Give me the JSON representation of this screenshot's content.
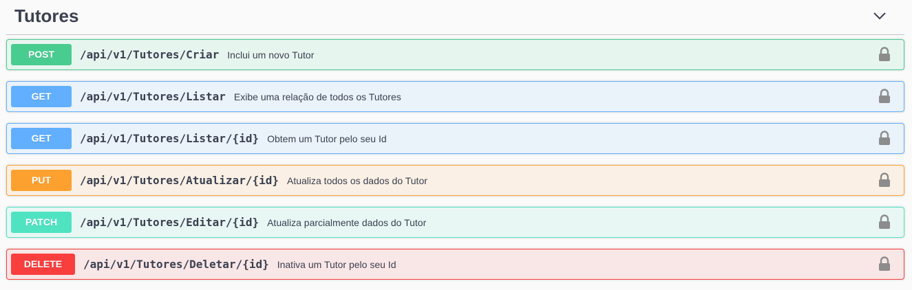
{
  "section": {
    "title": "Tutores",
    "toggle_icon": "chevron-down-icon"
  },
  "colors": {
    "post": "#49cc90",
    "get": "#61affe",
    "put": "#fca130",
    "patch": "#50e3c2",
    "delete": "#f93e3e",
    "text": "#3b4151"
  },
  "operations": [
    {
      "method": "POST",
      "path": "/api/v1/Tutores/Criar",
      "summary": "Inclui um novo Tutor",
      "lock_icon": "lock-icon"
    },
    {
      "method": "GET",
      "path": "/api/v1/Tutores/Listar",
      "summary": "Exibe uma relação de todos os Tutores",
      "lock_icon": "lock-icon"
    },
    {
      "method": "GET",
      "path": "/api/v1/Tutores/Listar/{id}",
      "summary": "Obtem um Tutor pelo seu Id",
      "lock_icon": "lock-icon"
    },
    {
      "method": "PUT",
      "path": "/api/v1/Tutores/Atualizar/{id}",
      "summary": "Atualiza todos os dados do Tutor",
      "lock_icon": "lock-icon"
    },
    {
      "method": "PATCH",
      "path": "/api/v1/Tutores/Editar/{id}",
      "summary": "Atualiza parcialmente dados do Tutor",
      "lock_icon": "lock-icon"
    },
    {
      "method": "DELETE",
      "path": "/api/v1/Tutores/Deletar/{id}",
      "summary": "Inativa um Tutor pelo seu Id",
      "lock_icon": "lock-icon"
    }
  ]
}
